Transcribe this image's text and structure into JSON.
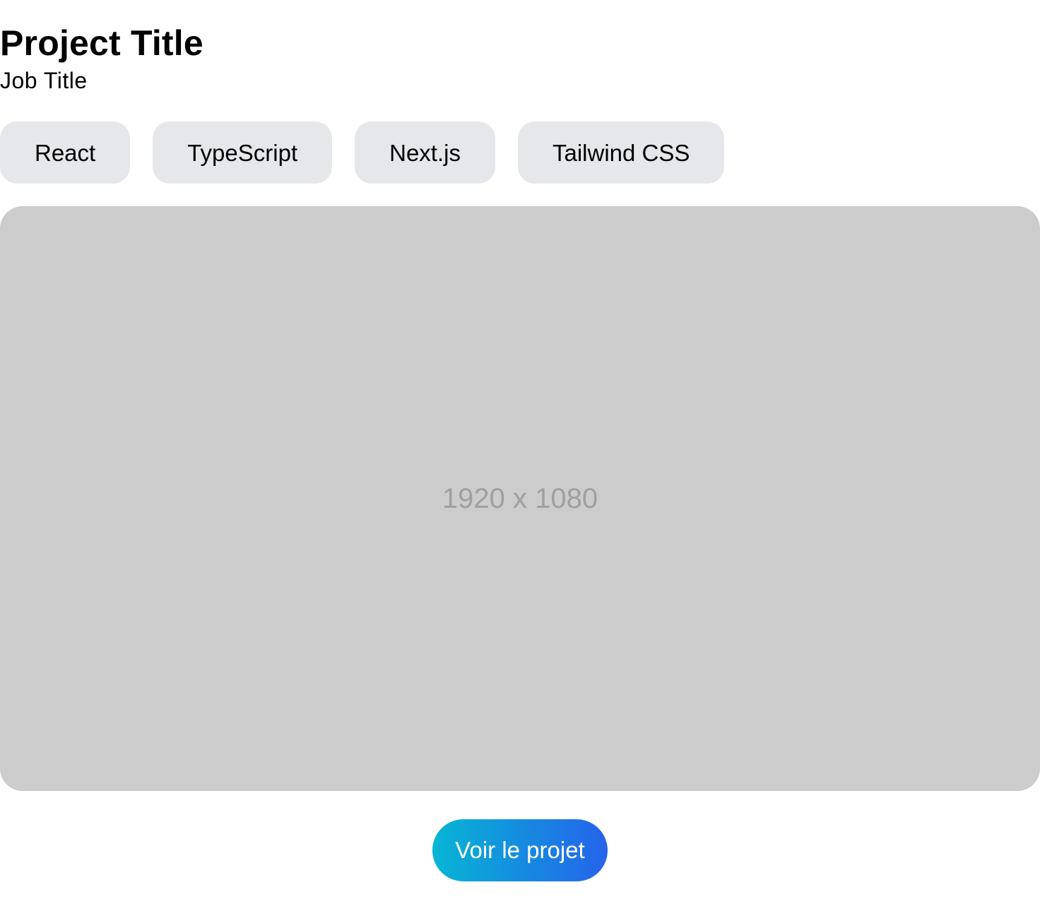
{
  "header": {
    "title": "Project Title",
    "subtitle": "Job Title"
  },
  "tags": [
    {
      "label": "React"
    },
    {
      "label": "TypeScript"
    },
    {
      "label": "Next.js"
    },
    {
      "label": "Tailwind CSS"
    }
  ],
  "media": {
    "placeholder_label": "1920 x 1080"
  },
  "cta": {
    "label": "Voir le projet"
  },
  "colors": {
    "tag_background": "#e5e7eb",
    "media_background": "#cccccc",
    "media_label": "#a0a0a0",
    "cta_gradient_start": "#06b6d4",
    "cta_gradient_end": "#2563eb"
  }
}
